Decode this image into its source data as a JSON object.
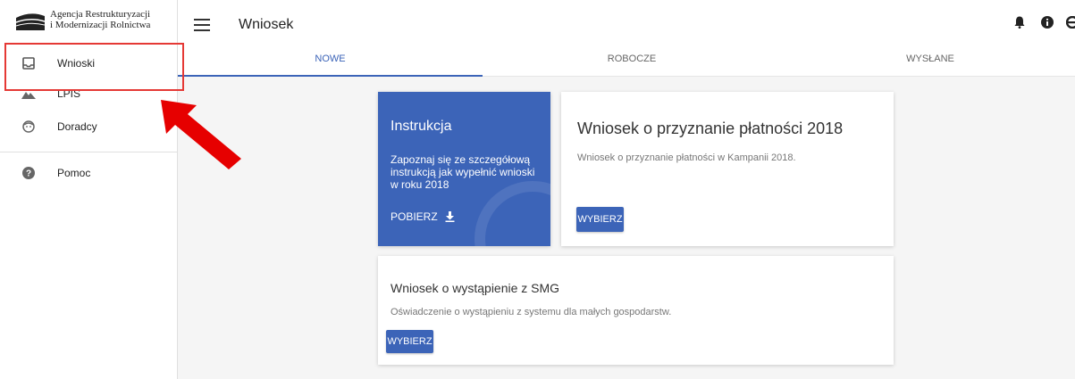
{
  "app": {
    "logo_line1": "Agencja Restrukturyzacji",
    "logo_line2": "i Modernizacji Rolnictwa",
    "logo_icon": "arimr-logo-icon"
  },
  "header": {
    "title": "Wniosek",
    "icons": [
      "menu-icon",
      "bell-icon",
      "info-icon",
      "account-icon"
    ]
  },
  "sidebar": {
    "items": [
      {
        "label": "Wnioski",
        "icon": "inbox-icon"
      },
      {
        "label": "LPIS",
        "icon": "terrain-icon"
      },
      {
        "label": "Doradcy",
        "icon": "face-icon"
      },
      {
        "label": "Pomoc",
        "icon": "help-icon"
      }
    ]
  },
  "tabs": [
    {
      "label": "NOWE",
      "active": true
    },
    {
      "label": "ROBOCZE",
      "active": false
    },
    {
      "label": "WYSŁANE",
      "active": false
    }
  ],
  "instruction_card": {
    "title": "Instrukcja",
    "text": "Zapoznaj się ze szczegółową instrukcją jak wypełnić wnioski w roku 2018",
    "download_label": "POBIERZ",
    "download_icon": "download-icon"
  },
  "cards": [
    {
      "title": "Wniosek o przyznanie płatności 2018",
      "description": "Wniosek o przyznanie płatności w Kampanii 2018.",
      "button": "WYBIERZ"
    },
    {
      "title": "Wniosek o wystąpienie z SMG",
      "description": "Oświadczenie o wystąpieniu z systemu dla małych gospodarstw.",
      "button": "WYBIERZ"
    }
  ],
  "colors": {
    "primary": "#3c64b8",
    "highlight": "#e53935",
    "arrow": "#e60000"
  }
}
